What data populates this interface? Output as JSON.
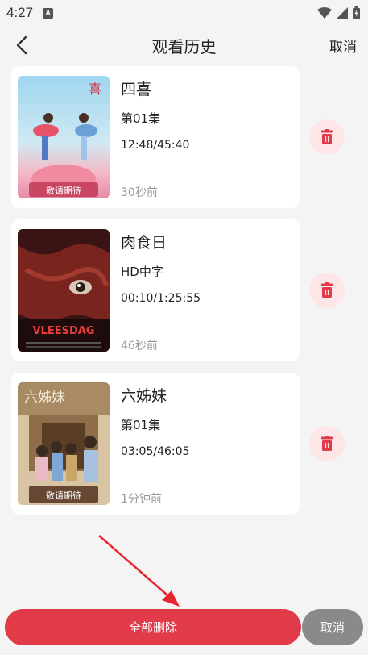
{
  "status_bar": {
    "time": "4:27",
    "badge": "A"
  },
  "header": {
    "title": "观看历史",
    "cancel_label": "取消"
  },
  "history": [
    {
      "title": "四喜",
      "episode": "第01集",
      "progress": "12:48/45:40",
      "ago": "30秒前",
      "poster_caption": "敬请期待"
    },
    {
      "title": "肉食日",
      "episode": "HD中字",
      "progress": "00:10/1:25:55",
      "ago": "46秒前",
      "poster_caption": "VLEESDAG"
    },
    {
      "title": "六姊妹",
      "episode": "第01集",
      "progress": "03:05/46:05",
      "ago": "1分钟前",
      "poster_caption": "敬请期待",
      "poster_title": "六姊妹"
    }
  ],
  "bottom": {
    "delete_all_label": "全部删除",
    "cancel_label": "取消"
  },
  "colors": {
    "accent": "#e13a49",
    "delete_bg": "#fde6e8",
    "cancel_gray": "#8a8a8a"
  },
  "icons": {
    "back": "chevron-left-icon",
    "delete": "trash-icon",
    "arrow": "red-arrow-annotation"
  }
}
